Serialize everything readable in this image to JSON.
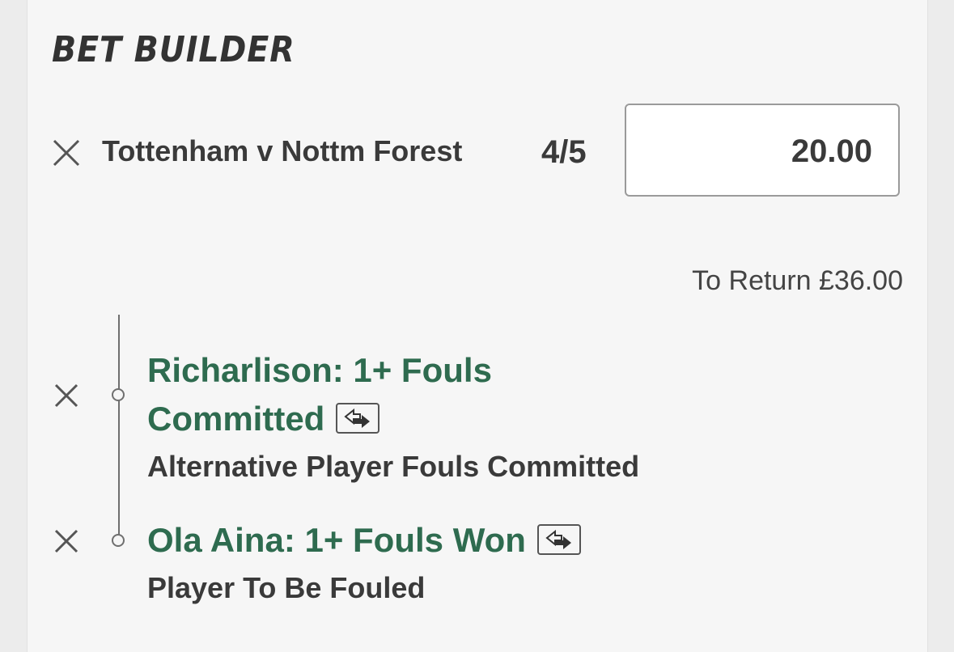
{
  "header": {
    "title": "BET BUILDER"
  },
  "selection": {
    "event": "Tottenham v Nottm Forest",
    "odds": "4/5",
    "stake": "20.00",
    "to_return": "To Return £36.00"
  },
  "legs": [
    {
      "title_line1": "Richarlison: 1+ Fouls",
      "title_line2": "Committed",
      "market": "Alternative Player Fouls Committed"
    },
    {
      "title_line1": "Ola Aina: 1+ Fouls Won",
      "market": "Player To Be Fouled"
    }
  ],
  "colors": {
    "leg_title": "#2e6b4f",
    "text": "#3a3a3a",
    "background": "#f6f6f6"
  },
  "icons": {
    "remove": "close-icon",
    "swap": "swap-arrows-icon"
  }
}
